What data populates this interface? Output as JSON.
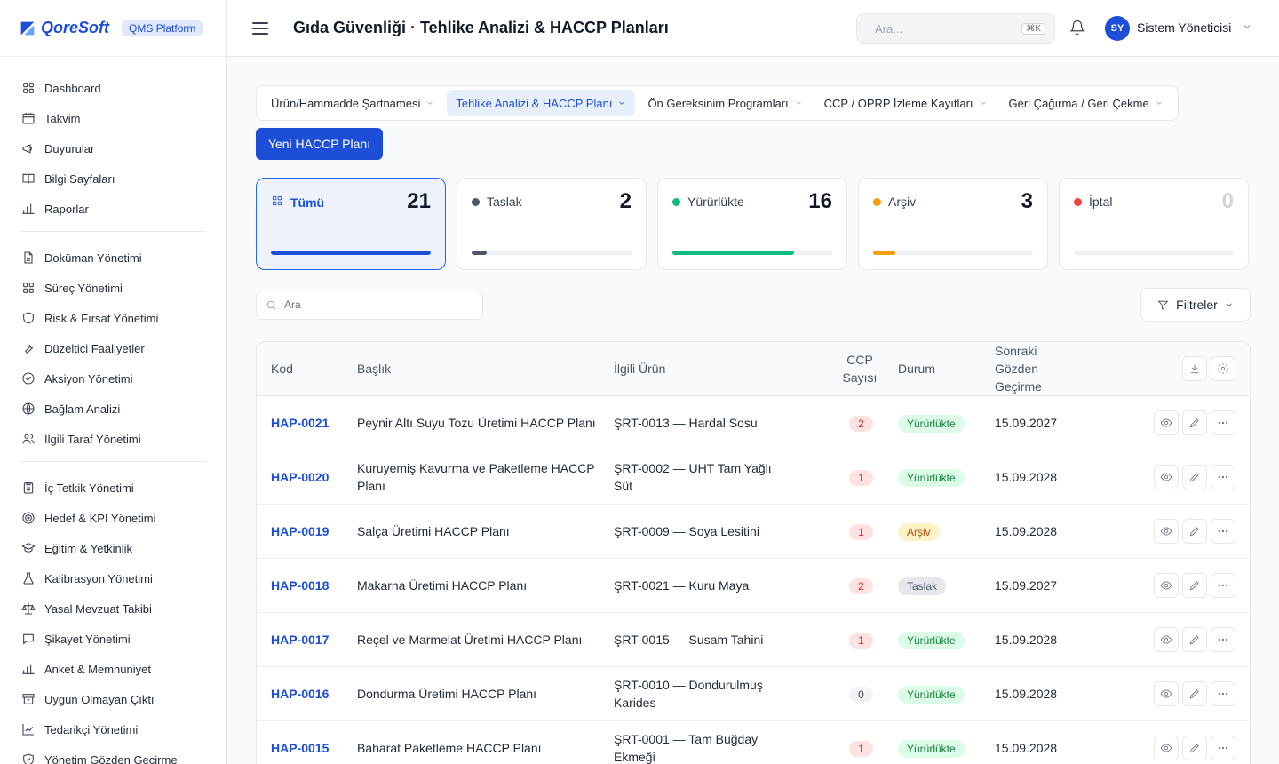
{
  "brand": {
    "name": "QoreSoft",
    "badge": "QMS Platform"
  },
  "header": {
    "title": "Gıda Güvenliği · Tehlike Analizi & HACCP Planları",
    "search_placeholder": "Ara...",
    "search_shortcut": "⌘K",
    "user_initials": "SY",
    "user_name": "Sistem Yöneticisi"
  },
  "sidebar": {
    "groups": [
      [
        {
          "label": "Dashboard",
          "icon": "grid-icon"
        },
        {
          "label": "Takvim",
          "icon": "calendar-icon"
        },
        {
          "label": "Duyurular",
          "icon": "megaphone-icon"
        },
        {
          "label": "Bilgi Sayfaları",
          "icon": "book-icon"
        },
        {
          "label": "Raporlar",
          "icon": "bar-chart-icon"
        }
      ],
      [
        {
          "label": "Doküman Yönetimi",
          "icon": "document-icon"
        },
        {
          "label": "Süreç Yönetimi",
          "icon": "grid-icon"
        },
        {
          "label": "Risk & Fırsat Yönetimi",
          "icon": "shield-icon"
        },
        {
          "label": "Düzeltici Faaliyetler",
          "icon": "wrench-icon"
        },
        {
          "label": "Aksiyon Yönetimi",
          "icon": "check-circle-icon"
        },
        {
          "label": "Bağlam Analizi",
          "icon": "globe-icon"
        },
        {
          "label": "İlgili Taraf Yönetimi",
          "icon": "users-icon"
        }
      ],
      [
        {
          "label": "İç Tetkik Yönetimi",
          "icon": "clipboard-icon"
        },
        {
          "label": "Hedef & KPI Yönetimi",
          "icon": "target-icon"
        },
        {
          "label": "Eğitim & Yetkinlik",
          "icon": "graduation-cap-icon"
        },
        {
          "label": "Kalibrasyon Yönetimi",
          "icon": "flask-icon"
        },
        {
          "label": "Yasal Mevzuat Takibi",
          "icon": "scale-icon"
        },
        {
          "label": "Şikayet Yönetimi",
          "icon": "message-icon"
        },
        {
          "label": "Anket & Memnuniyet",
          "icon": "bar-chart-icon"
        },
        {
          "label": "Uygun Olmayan Çıktı",
          "icon": "archive-icon"
        },
        {
          "label": "Tedarikçi Yönetimi",
          "icon": "chart-line-icon"
        },
        {
          "label": "Yönetim Gözden Geçirme",
          "icon": "shield-check-icon"
        }
      ]
    ]
  },
  "tabs": [
    {
      "label": "Ürün/Hammadde Şartnamesi",
      "active": false
    },
    {
      "label": "Tehlike Analizi & HACCP Planı",
      "active": true
    },
    {
      "label": "Ön Gereksinim Programları",
      "active": false
    },
    {
      "label": "CCP / OPRP İzleme Kayıtları",
      "active": false
    },
    {
      "label": "Geri Çağırma / Geri Çekme",
      "active": false
    }
  ],
  "new_button": "Yeni HACCP Planı",
  "status_cards": [
    {
      "label": "Tümü",
      "count": "21",
      "fill": 1.0,
      "color": "#1d4ed8",
      "active": true
    },
    {
      "label": "Taslak",
      "count": "2",
      "fill": 0.095,
      "color": "#4b5563",
      "active": false
    },
    {
      "label": "Yürürlükte",
      "count": "16",
      "fill": 0.76,
      "color": "#10b981",
      "active": false
    },
    {
      "label": "Arşiv",
      "count": "3",
      "fill": 0.14,
      "color": "#f59e0b",
      "active": false
    },
    {
      "label": "İptal",
      "count": "0",
      "fill": 0.0,
      "color": "#ef4444",
      "active": false
    }
  ],
  "list_search_placeholder": "Ara",
  "filter_label": "Filtreler",
  "table": {
    "headers": {
      "kod": "Kod",
      "baslik": "Başlık",
      "urun": "İlgili Ürün",
      "ccp": "CCP Sayısı",
      "durum": "Durum",
      "tarih": "Sonraki Gözden Geçirme"
    },
    "rows": [
      {
        "kod": "HAP-0021",
        "baslik": "Peynir Altı Suyu Tozu Üretimi HACCP Planı",
        "urun": "ŞRT-0013 — Hardal Sosu",
        "ccp": "2",
        "durum": "Yürürlükte",
        "tarih": "15.09.2027"
      },
      {
        "kod": "HAP-0020",
        "baslik": "Kuruyemiş Kavurma ve Paketleme HACCP Planı",
        "urun": "ŞRT-0002 — UHT Tam Yağlı Süt",
        "ccp": "1",
        "durum": "Yürürlükte",
        "tarih": "15.09.2028"
      },
      {
        "kod": "HAP-0019",
        "baslik": "Salça Üretimi HACCP Planı",
        "urun": "ŞRT-0009 — Soya Lesitini",
        "ccp": "1",
        "durum": "Arşiv",
        "tarih": "15.09.2028"
      },
      {
        "kod": "HAP-0018",
        "baslik": "Makarna Üretimi HACCP Planı",
        "urun": "ŞRT-0021 — Kuru Maya",
        "ccp": "2",
        "durum": "Taslak",
        "tarih": "15.09.2027"
      },
      {
        "kod": "HAP-0017",
        "baslik": "Reçel ve Marmelat Üretimi HACCP Planı",
        "urun": "ŞRT-0015 — Susam Tahini",
        "ccp": "1",
        "durum": "Yürürlükte",
        "tarih": "15.09.2028"
      },
      {
        "kod": "HAP-0016",
        "baslik": "Dondurma Üretimi HACCP Planı",
        "urun": "ŞRT-0010 — Dondurulmuş Karides",
        "ccp": "0",
        "durum": "Yürürlükte",
        "tarih": "15.09.2028"
      },
      {
        "kod": "HAP-0015",
        "baslik": "Baharat Paketleme HACCP Planı",
        "urun": "ŞRT-0001 — Tam Buğday Ekmeği",
        "ccp": "1",
        "durum": "Yürürlükte",
        "tarih": "15.09.2028"
      }
    ]
  }
}
